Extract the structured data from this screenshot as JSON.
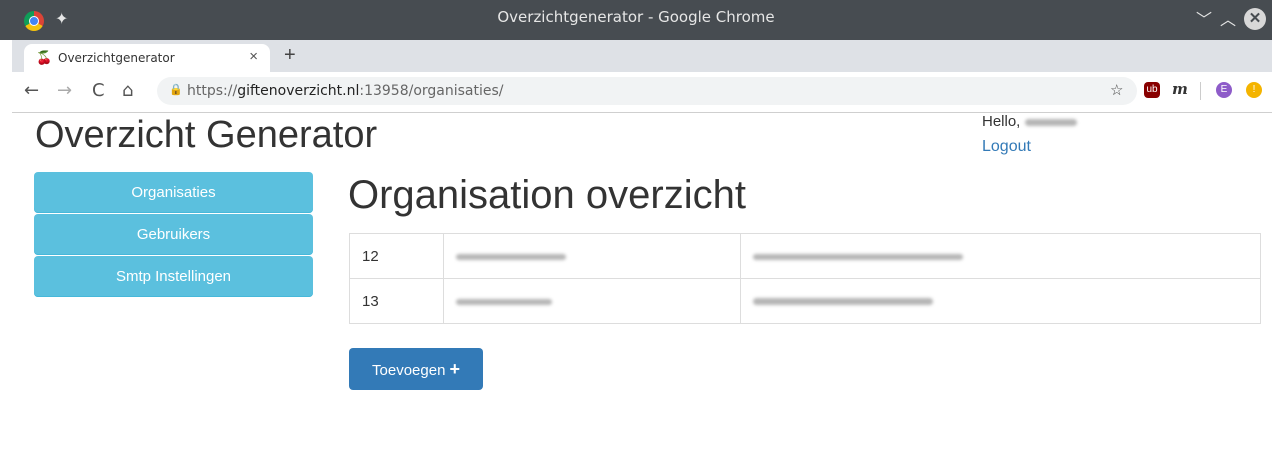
{
  "window": {
    "title": "Overzichtgenerator - Google Chrome",
    "controls": {
      "minimize": "﹀",
      "maximize": "︿",
      "close": "✕"
    }
  },
  "browser": {
    "tab_title": "Overzichtgenerator",
    "tab_close": "×",
    "new_tab": "+",
    "url_scheme": "https://",
    "url_host": "giftenoverzicht.nl",
    "url_rest": ":13958/organisaties/",
    "nav": {
      "back": "←",
      "forward": "→",
      "reload": "C",
      "home": "⌂"
    },
    "bookmark_star": "☆",
    "extensions": {
      "ublock": "ub",
      "m": "m",
      "profile": "E",
      "alert": "!"
    }
  },
  "app": {
    "title": "Overzicht Generator",
    "hello": "Hello,",
    "logout": "Logout"
  },
  "sidebar": {
    "items": [
      {
        "label": "Organisaties"
      },
      {
        "label": "Gebruikers"
      },
      {
        "label": "Smtp Instellingen"
      }
    ]
  },
  "main": {
    "heading": "Organisation overzicht",
    "rows": [
      {
        "id": "12"
      },
      {
        "id": "13"
      }
    ],
    "add_button": "Toevoegen",
    "add_button_icon": "+"
  }
}
